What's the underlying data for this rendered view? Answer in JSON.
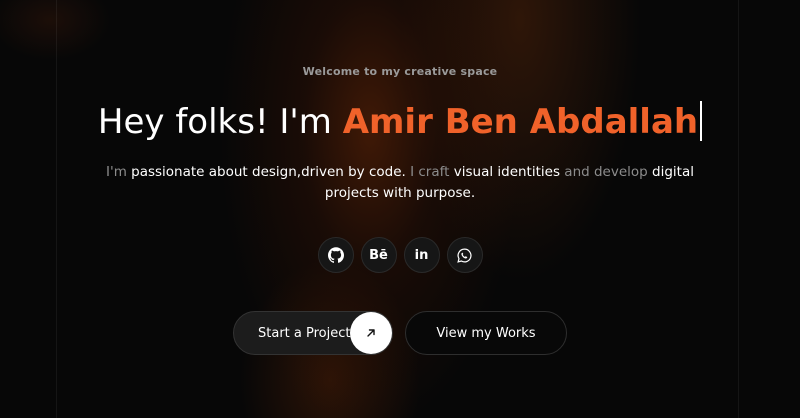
{
  "hero": {
    "welcome": "Welcome to my creative space",
    "headline_prefix": "Hey folks! I'm ",
    "headline_name": "Amir Ben Abdallah",
    "intro": {
      "p1": "I'm ",
      "p2": "passionate about design,driven by code.",
      "p3": " I craft ",
      "p4": "visual identities",
      "p5": " and develop ",
      "p6": "digital projects with purpose."
    }
  },
  "socials": [
    {
      "icon": "github-icon",
      "label": ""
    },
    {
      "icon": "behance-icon",
      "label": "Bē"
    },
    {
      "icon": "linkedin-icon",
      "label": "in"
    },
    {
      "icon": "whatsapp-icon",
      "label": ""
    }
  ],
  "cta": {
    "primary_label": "Start a Project",
    "secondary_label": "View my Works"
  },
  "colors": {
    "accent": "#f0622a",
    "background": "#070707"
  }
}
